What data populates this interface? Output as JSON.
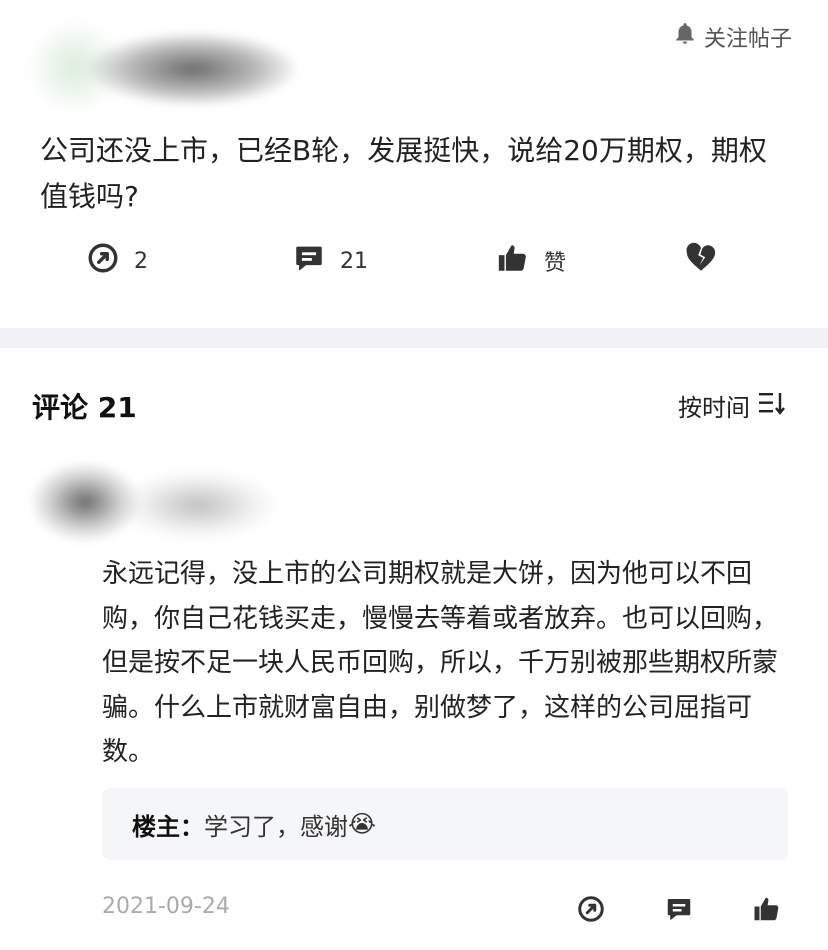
{
  "post": {
    "follow_label": "关注帖子",
    "text": "公司还没上市，已经B轮，发展挺快，说给20万期权，期权值钱吗?",
    "share_count": "2",
    "comment_count": "21",
    "like_label": "赞"
  },
  "comments": {
    "header": "评论 21",
    "sort_label": "按时间"
  },
  "comment": {
    "text": "永远记得，没上市的公司期权就是大饼，因为他可以不回购，你自己花钱买走，慢慢去等着或者放弃。也可以回购，但是按不足一块人民币回购，所以，千万别被那些期权所蒙骗。什么上市就财富自由，别做梦了，这样的公司屈指可数。",
    "reply_author": "楼主：",
    "reply_text": "学习了，感谢",
    "reply_emoji": "😭",
    "date": "2021-09-24"
  },
  "colors": {
    "icon": "#333333",
    "divider": "#f2f2f4",
    "reply_bg": "#f5f6f8",
    "date": "#aaaaaa"
  }
}
